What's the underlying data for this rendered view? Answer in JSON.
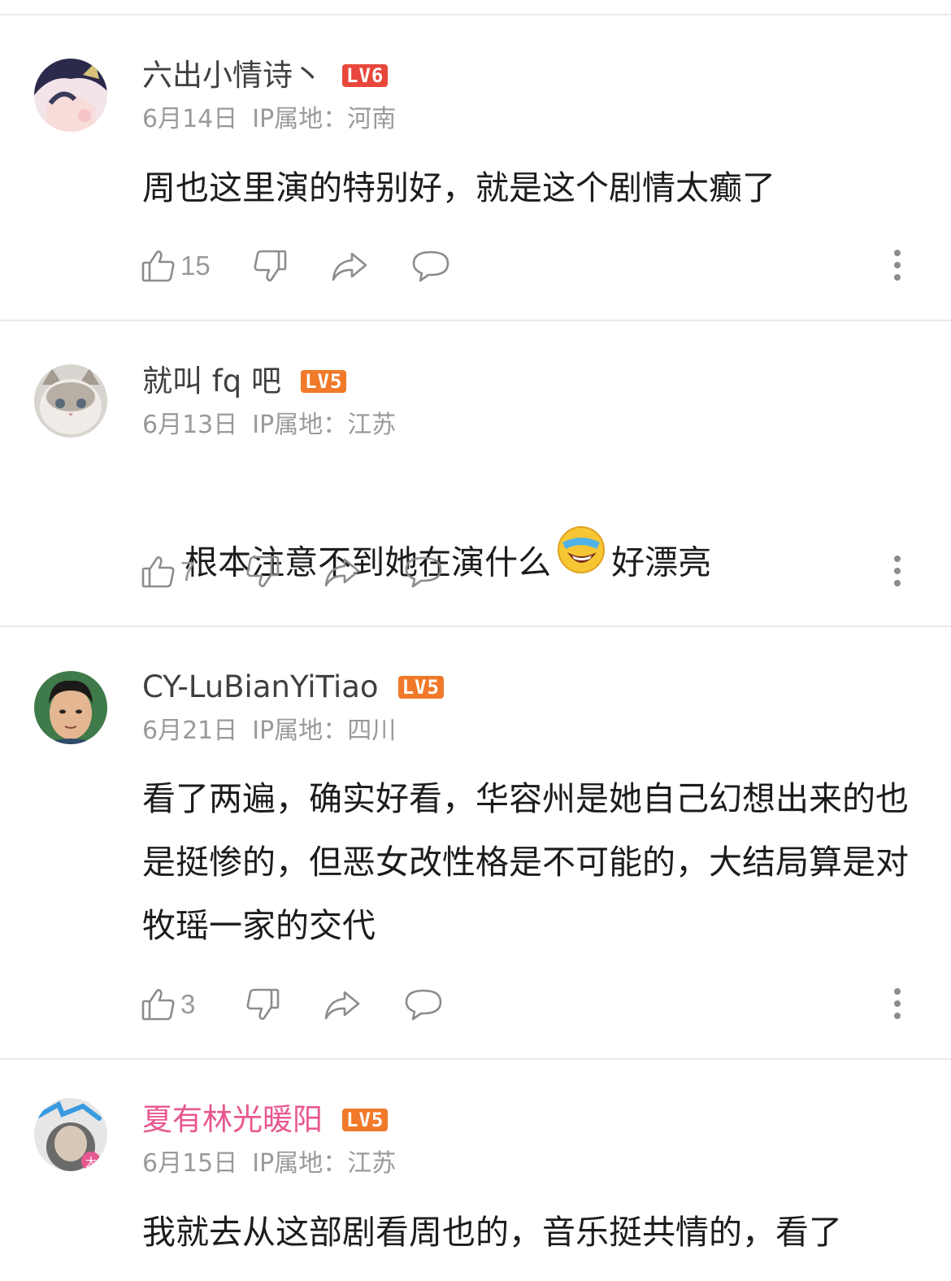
{
  "comments": [
    {
      "username": "六出小情诗丶",
      "level": "LV6",
      "level_color": "#e8473b",
      "date": "6月14日",
      "ip": "IP属地：河南",
      "text": "周也这里演的特别好，就是这个剧情太癫了",
      "likes": "15"
    },
    {
      "username": "就叫 fq 吧",
      "level": "LV5",
      "level_color": "#f07a2a",
      "date": "6月13日",
      "ip": "IP属地：江苏",
      "text_before": "根本注意不到她在演什么",
      "emoji": "laughing-crying-emoji",
      "text_after": "好漂亮",
      "likes": "7"
    },
    {
      "username": "CY-LuBianYiTiao",
      "level": "LV5",
      "level_color": "#f07a2a",
      "date": "6月21日",
      "ip": "IP属地：四川",
      "text": "看了两遍，确实好看，华容州是她自己幻想出来的也是挺惨的，但恶女改性格是不可能的，大结局算是对牧瑶一家的交代",
      "likes": "3"
    },
    {
      "username": "夏有林光暖阳",
      "level": "LV5",
      "level_color": "#f07a2a",
      "date": "6月15日",
      "ip": "IP属地：江苏",
      "text": "我就去从这部剧看周也的，音乐挺共情的，看了"
    }
  ],
  "icons": {
    "like": "thumbs-up-icon",
    "dislike": "thumbs-down-icon",
    "share": "share-icon",
    "reply": "comment-icon",
    "more": "more-vertical-icon"
  },
  "colors": {
    "username_vip": "#e8578f",
    "meta": "#9a9a9a",
    "divider": "#e9e9e9"
  }
}
